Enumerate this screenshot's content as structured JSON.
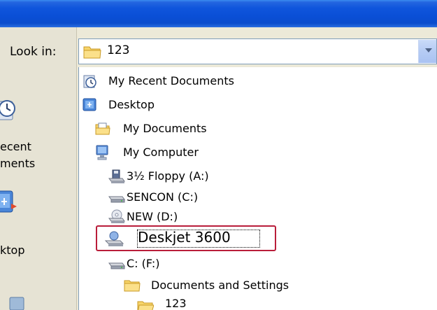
{
  "dialog": {
    "look_in_label": "Look in:",
    "current_folder": "123"
  },
  "places": [
    {
      "label_line1": "ecent",
      "label_line2": "ments",
      "icon": "recent-documents-icon"
    },
    {
      "label_line1": "ktop",
      "icon": "desktop-icon"
    },
    {
      "icon": "network-icon"
    }
  ],
  "tree": {
    "items": [
      {
        "label": "My Recent Documents",
        "icon": "recent-documents-icon",
        "level": 0
      },
      {
        "label": "Desktop",
        "icon": "desktop-icon",
        "level": 0
      },
      {
        "label": "My Documents",
        "icon": "my-documents-icon",
        "level": 1
      },
      {
        "label": "My Computer",
        "icon": "my-computer-icon",
        "level": 1
      },
      {
        "label": "3½ Floppy (A:)",
        "icon": "floppy-drive-icon",
        "level": 2
      },
      {
        "label": "SENCON (C:)",
        "icon": "hard-drive-icon",
        "level": 2
      },
      {
        "label": "NEW (D:)",
        "icon": "cd-drive-icon",
        "level": 2
      },
      {
        "label": "Deskjet 3600",
        "icon": "printer-drive-icon",
        "level": 2,
        "highlighted": true
      },
      {
        "label": "C: (F:)",
        "icon": "hard-drive-icon",
        "level": 2
      },
      {
        "label": "Documents and Settings",
        "icon": "folder-icon",
        "level": 3
      },
      {
        "label": "123",
        "icon": "folder-open-icon",
        "level": 4
      }
    ]
  },
  "colors": {
    "titlebar": "#0a4fd6",
    "highlight_border": "#b91d3a",
    "combo_border": "#7f9db9"
  }
}
